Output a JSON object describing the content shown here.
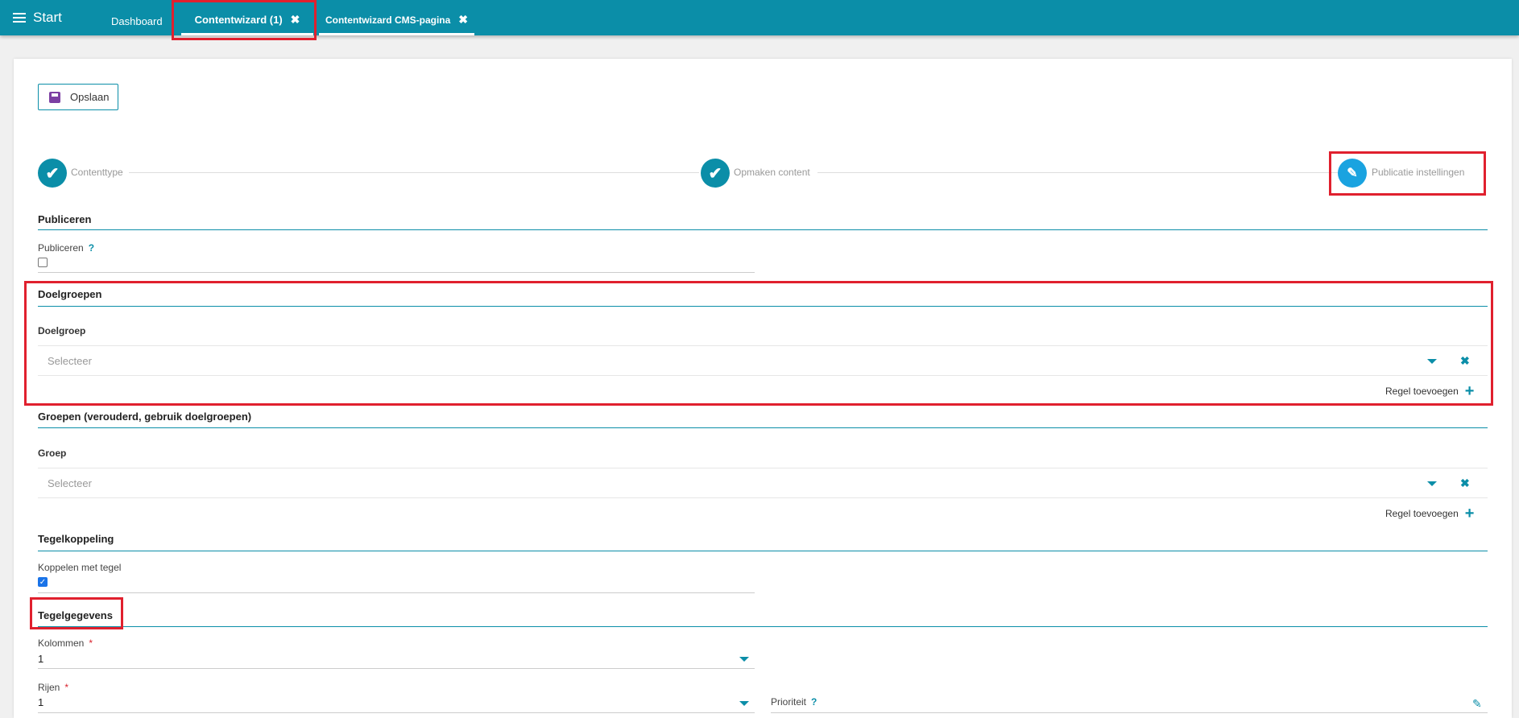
{
  "topbar": {
    "start_label": "Start",
    "tabs": [
      {
        "label": "Dashboard",
        "close": ""
      },
      {
        "label": "Contentwizard (1)",
        "close": "✖"
      },
      {
        "label": "Contentwizard CMS-pagina",
        "close": "✖"
      }
    ]
  },
  "toolbar": {
    "save_label": "Opslaan"
  },
  "stepper": {
    "steps": [
      {
        "label": "Contenttype",
        "status": "done"
      },
      {
        "label": "Opmaken content",
        "status": "done"
      },
      {
        "label": "Publicatie instellingen",
        "status": "active"
      }
    ]
  },
  "publiceren": {
    "title": "Publiceren",
    "field_label": "Publiceren",
    "help": "?",
    "checked": false
  },
  "doelgroepen": {
    "title": "Doelgroepen",
    "field_label": "Doelgroep",
    "placeholder": "Selecteer",
    "add_label": "Regel toevoegen"
  },
  "groepen": {
    "title": "Groepen (verouderd, gebruik doelgroepen)",
    "field_label": "Groep",
    "placeholder": "Selecteer",
    "add_label": "Regel toevoegen"
  },
  "tegelkoppeling": {
    "title": "Tegelkoppeling",
    "field_label": "Koppelen met tegel",
    "checked": true
  },
  "tegelgegevens": {
    "title": "Tegelgegevens",
    "kolommen_label": "Kolommen",
    "kolommen_value": "1",
    "rijen_label": "Rijen",
    "rijen_value": "1",
    "prioriteit_label": "Prioriteit",
    "required_mark": "*",
    "help": "?"
  },
  "colors": {
    "accent": "#0b8ea8",
    "highlight": "#e0202e",
    "active_step": "#1aa3e0"
  },
  "icons": [
    "menu-icon",
    "close-icon",
    "floppy-disk-icon",
    "check-icon",
    "pencil-icon",
    "chevron-down-icon",
    "plus-icon"
  ]
}
